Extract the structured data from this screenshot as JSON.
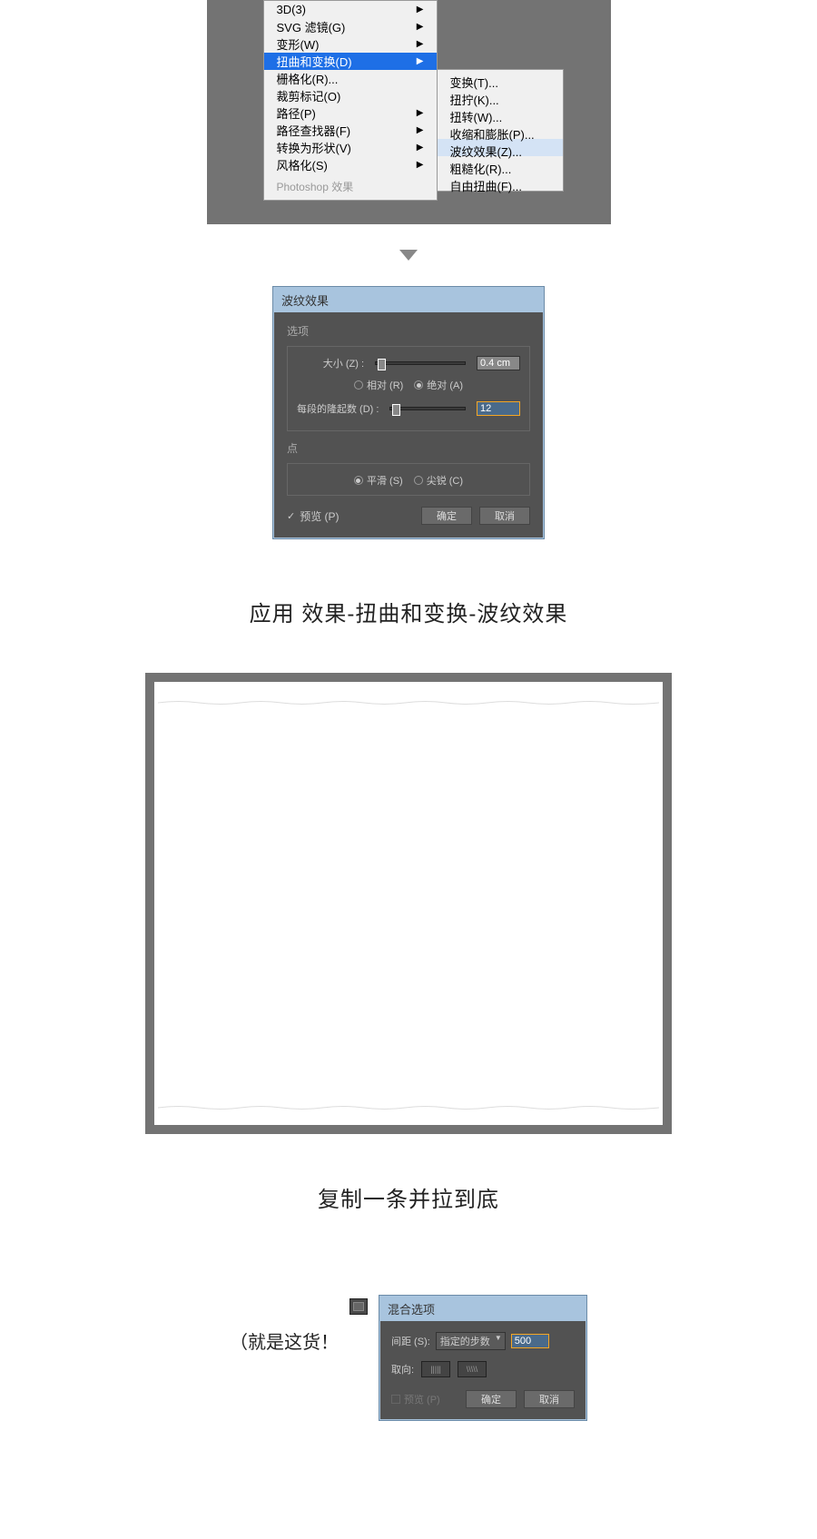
{
  "menu": {
    "items": [
      {
        "label": "3D(3)",
        "arrow": true
      },
      {
        "label": "SVG 滤镜(G)",
        "arrow": true
      },
      {
        "label": "变形(W)",
        "arrow": true
      },
      {
        "label": "扭曲和变换(D)",
        "arrow": true,
        "hl": true
      },
      {
        "label": "栅格化(R)...",
        "arrow": false
      },
      {
        "label": "裁剪标记(O)",
        "arrow": false
      },
      {
        "label": "路径(P)",
        "arrow": true
      },
      {
        "label": "路径查找器(F)",
        "arrow": true
      },
      {
        "label": "转换为形状(V)",
        "arrow": true
      },
      {
        "label": "风格化(S)",
        "arrow": true
      }
    ],
    "disabled": "Photoshop 效果"
  },
  "submenu": {
    "items": [
      {
        "label": "变换(T)..."
      },
      {
        "label": "扭拧(K)..."
      },
      {
        "label": "扭转(W)..."
      },
      {
        "label": "收缩和膨胀(P)..."
      },
      {
        "label": "波纹效果(Z)...",
        "hl": true
      },
      {
        "label": "粗糙化(R)..."
      },
      {
        "label": "自由扭曲(F)..."
      }
    ]
  },
  "dialog": {
    "title": "波纹效果",
    "group1_label": "选项",
    "size_label": "大小 (Z) :",
    "size_value": "0.4 cm",
    "radio_rel": "相对 (R)",
    "radio_abs": "绝对 (A)",
    "ridges_label": "每段的隆起数 (D) :",
    "ridges_value": "12",
    "group2_label": "点",
    "radio_smooth": "平滑 (S)",
    "radio_corner": "尖锐 (C)",
    "preview": "预览 (P)",
    "ok": "确定",
    "cancel": "取消"
  },
  "caption1": "应用 效果-扭曲和变换-波纹效果",
  "caption2": "复制一条并拉到底",
  "bottom_label": "（就是这货！",
  "dialog2": {
    "title": "混合选项",
    "spacing_label": "间距 (S):",
    "spacing_mode": "指定的步数",
    "spacing_value": "500",
    "orient_label": "取向:",
    "preview": "预览 (P)",
    "ok": "确定",
    "cancel": "取消"
  }
}
